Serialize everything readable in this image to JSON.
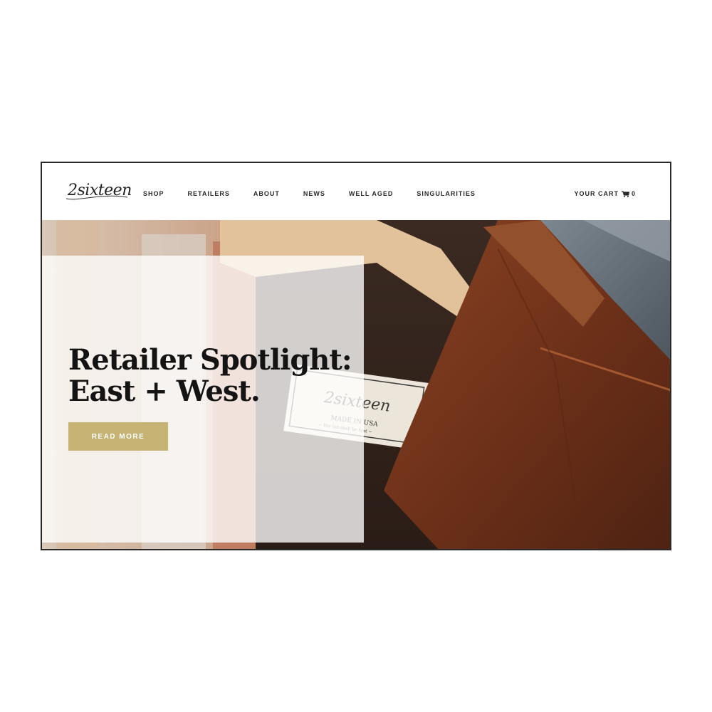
{
  "brand": {
    "logo_text": "2sixteen"
  },
  "nav": {
    "items": [
      {
        "label": "SHOP"
      },
      {
        "label": "RETAILERS"
      },
      {
        "label": "ABOUT"
      },
      {
        "label": "NEWS"
      },
      {
        "label": "WELL AGED"
      },
      {
        "label": "SINGULARITIES"
      }
    ]
  },
  "cart": {
    "label": "YOUR CART",
    "count": "0",
    "icon": "cart-icon"
  },
  "hero": {
    "headline_line1": "Retailer Spotlight:",
    "headline_line2": "East + West.",
    "cta_label": "READ MORE",
    "tag_brand": "2sixteen",
    "tag_line1": "MADE IN USA",
    "tag_line2": "~ You too shall be first ~"
  },
  "colors": {
    "accent": "#c6b273",
    "text": "#141414",
    "shirt": "#7a3a1e"
  }
}
